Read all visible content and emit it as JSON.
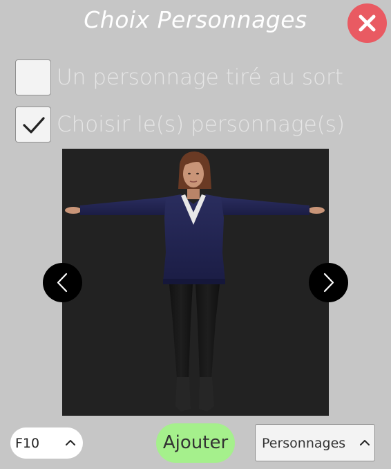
{
  "dialog": {
    "title": "Choix Personnages"
  },
  "options": {
    "random": {
      "label": "Un personnage tiré au sort",
      "checked": false
    },
    "choose": {
      "label": "Choisir le(s) personnage(s)",
      "checked": true
    }
  },
  "footer": {
    "level_value": "F10",
    "add_label": "Ajouter",
    "category_value": "Personnages"
  },
  "icons": {
    "close": "close-icon",
    "prev": "chevron-left-icon",
    "next": "chevron-right-icon",
    "check": "checkmark-icon",
    "dropdown": "chevron-up-icon"
  },
  "colors": {
    "background": "#c6c6c6",
    "close_button": "#e95a62",
    "add_button": "#a5f08c",
    "viewer_background": "#222222"
  }
}
